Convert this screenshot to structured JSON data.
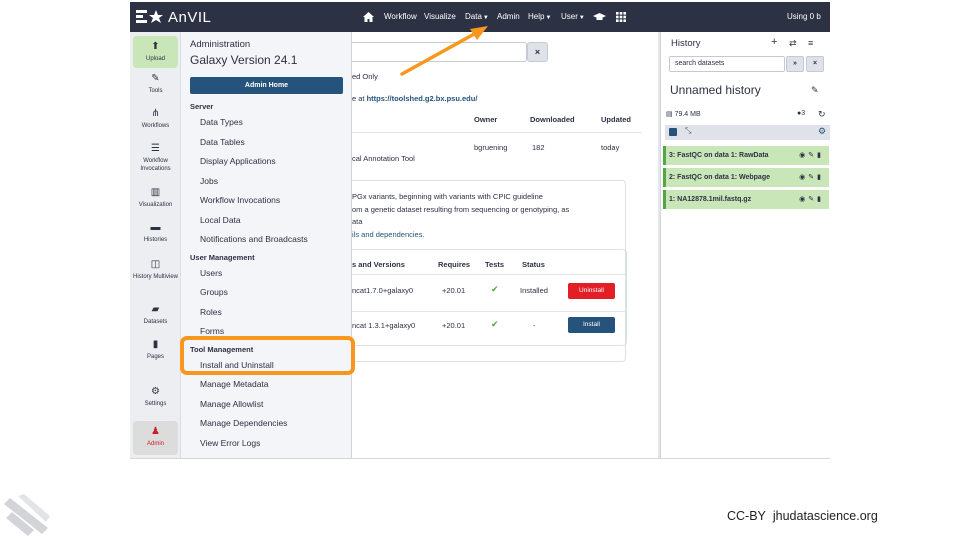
{
  "brand": {
    "name": "AnVIL"
  },
  "navbar": {
    "items": [
      {
        "label": "Workflow"
      },
      {
        "label": "Visualize"
      },
      {
        "label": "Data"
      },
      {
        "label": "Admin"
      },
      {
        "label": "Help"
      },
      {
        "label": "User"
      }
    ],
    "using": "Using 0 b"
  },
  "activity": {
    "items": [
      {
        "label": "Upload",
        "icon": "upload-icon"
      },
      {
        "label": "Tools",
        "icon": "wrench-icon"
      },
      {
        "label": "Workflows",
        "icon": "sitemap-icon"
      },
      {
        "label": "Workflow Invocations",
        "icon": "list-icon"
      },
      {
        "label": "Visualization",
        "icon": "chart-icon"
      },
      {
        "label": "Histories",
        "icon": "hdd-icon"
      },
      {
        "label": "History Multiview",
        "icon": "columns-icon"
      },
      {
        "label": "Datasets",
        "icon": "folder-icon"
      },
      {
        "label": "Pages",
        "icon": "file-icon"
      },
      {
        "label": "Settings",
        "icon": "gear-icon"
      },
      {
        "label": "Admin",
        "icon": "user-gear-icon"
      }
    ]
  },
  "admin": {
    "title": "Administration",
    "version": "Galaxy Version 24.1",
    "home_button": "Admin Home",
    "server_heading": "Server",
    "server_items": [
      "Data Types",
      "Data Tables",
      "Display Applications",
      "Jobs",
      "Workflow Invocations",
      "Local Data",
      "Notifications and Broadcasts"
    ],
    "user_heading": "User Management",
    "user_items": [
      "Users",
      "Groups",
      "Roles",
      "Forms"
    ],
    "tool_heading": "Tool Management",
    "tool_items": [
      "Install and Uninstall",
      "Manage Metadata",
      "Manage Allowlist",
      "Manage Dependencies",
      "View Error Logs"
    ]
  },
  "center": {
    "clear_label": "×",
    "filter_text": "ed Only",
    "toolshed_prefix": "e at ",
    "toolshed_url": "https://toolshed.g2.bx.psu.edu/",
    "columns": {
      "owner": "Owner",
      "downloaded": "Downloaded",
      "updated": "Updated"
    },
    "row": {
      "owner": "bgruening",
      "downloaded": "182",
      "updated": "today",
      "desc": "cal Annotation Tool"
    },
    "desc_line1": "PGx variants, beginning with variants with CPIC guideline",
    "desc_line2": "om a genetic dataset resulting from sequencing or genotyping, as",
    "desc_line3": "ata",
    "desc_link": "ils and dependencies.",
    "req_columns": {
      "versions": "s and Versions",
      "requires": "Requires",
      "tests": "Tests",
      "status": "Status"
    },
    "req_rows": [
      {
        "version": "ncat1.7.0+galaxy0",
        "requires": "+20.01",
        "test": "✔",
        "status": "Installed",
        "action": "Uninstall"
      },
      {
        "version": "ncat 1.3.1+galaxy0",
        "requires": "+20.01",
        "test": "✔",
        "status": "-",
        "action": "Install"
      }
    ]
  },
  "history": {
    "title": "History",
    "search_placeholder": "search datasets",
    "name": "Unnamed history",
    "size": "79.4 MB",
    "count": "3",
    "datasets": [
      "3: FastQC on data 1: RawData",
      "2: FastQC on data 1: Webpage",
      "1: NA12878.1mil.fastq.gz"
    ]
  },
  "footer": {
    "license": "CC-BY",
    "site": "jhudatascience.org"
  },
  "colors": {
    "highlight": "#f7971e",
    "navbar": "#2c3143",
    "primary": "#25537b",
    "danger": "#e21f26",
    "dataset_ok": "#c9e6b8"
  }
}
